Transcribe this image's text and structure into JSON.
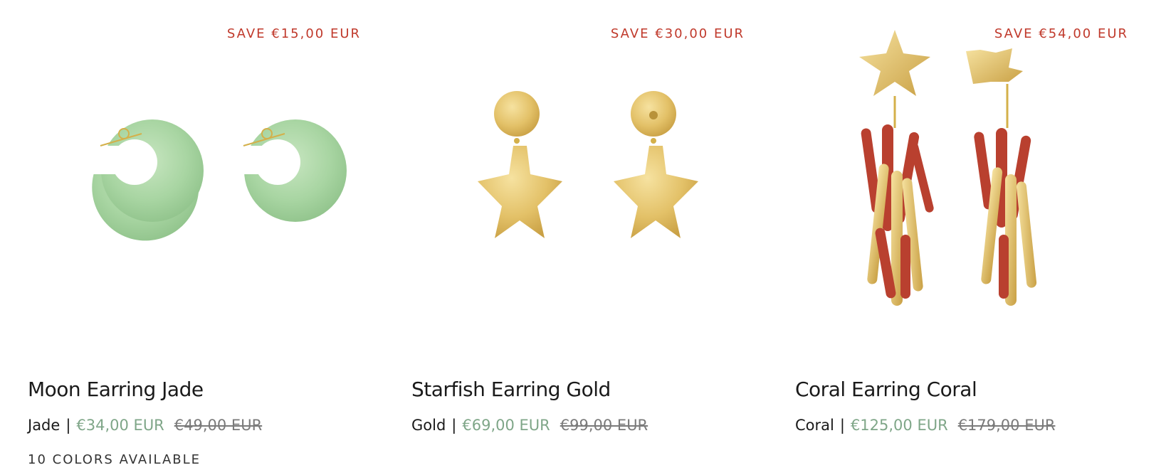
{
  "products": [
    {
      "save_label": "SAVE €15,00 EUR",
      "title": "Moon Earring Jade",
      "variant": "Jade",
      "separator": "|",
      "sale_price": "€34,00 EUR",
      "compare_price": "€49,00 EUR",
      "colors_available": "10 COLORS AVAILABLE"
    },
    {
      "save_label": "SAVE €30,00 EUR",
      "title": "Starfish Earring Gold",
      "variant": "Gold",
      "separator": "|",
      "sale_price": "€69,00 EUR",
      "compare_price": "€99,00 EUR"
    },
    {
      "save_label": "SAVE €54,00 EUR",
      "title": "Coral Earring Coral",
      "variant": "Coral",
      "separator": "|",
      "sale_price": "€125,00 EUR",
      "compare_price": "€179,00 EUR"
    }
  ],
  "colors": {
    "save_badge": "#c0392b",
    "sale_price": "#7fa688",
    "compare_price": "#7a7a7a",
    "jade": "#a8d5a2",
    "gold": "#e3c168",
    "coral": "#b9402f"
  }
}
